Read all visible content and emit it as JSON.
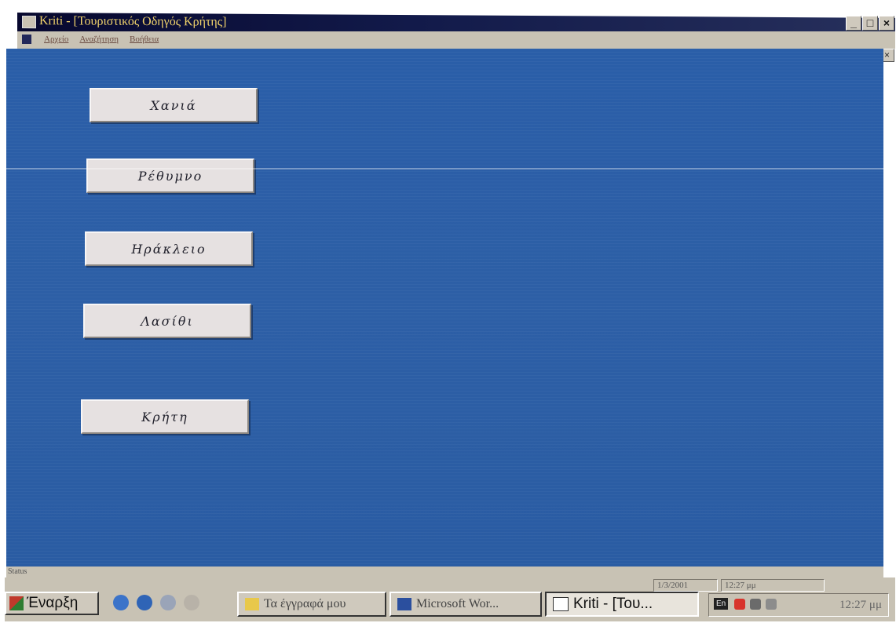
{
  "window": {
    "title": "Kriti - [Τουριστικός Οδηγός Κρήτης]",
    "controls": [
      "_",
      "□",
      "×"
    ],
    "mdi_controls": [
      "_",
      "🗗",
      "×"
    ]
  },
  "menu": {
    "items": [
      "Αρχείο",
      "Αναζήτηση",
      "Βοήθεια"
    ]
  },
  "main": {
    "buttons": [
      {
        "label": "Χανιά"
      },
      {
        "label": "Ρέθυμνο"
      },
      {
        "label": "Ηράκλειο"
      },
      {
        "label": "Λασίθι"
      },
      {
        "label": "Κρήτη"
      }
    ]
  },
  "statusbar": {
    "text": "Status",
    "date": "1/3/2001",
    "time": "12:27 μμ"
  },
  "taskbar": {
    "start_label": "Έναρξη",
    "tasks": [
      {
        "label": "Τα έγγραφά μου",
        "icon": "folder-icon"
      },
      {
        "label": "Microsoft Wor...",
        "icon": "word-icon"
      },
      {
        "label": "Kriti - [Του...",
        "icon": "window-icon"
      }
    ],
    "tray": {
      "language": "En",
      "clock": "12:27 μμ"
    }
  },
  "colors": {
    "client_bg": "#2b5ea7",
    "button_face": "#e6e1e1",
    "title_text": "#f1d36b",
    "chrome": "#c8c2b4"
  }
}
